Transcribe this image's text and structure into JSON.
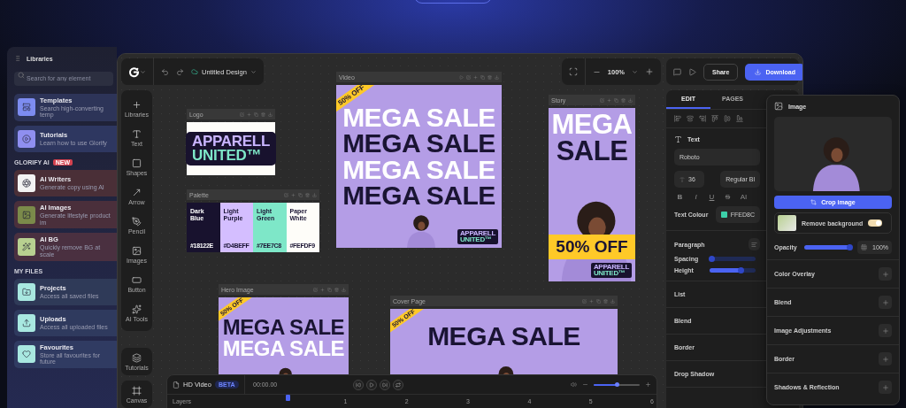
{
  "libraries": {
    "title": "Libraries",
    "search": {
      "placeholder": "Search for any element"
    },
    "groups": [
      {
        "items": [
          {
            "title": "Templates",
            "subtitle": "Search high-converting temp",
            "kind": "templates"
          },
          {
            "title": "Tutorials",
            "subtitle": "Learn how to use Glorify",
            "kind": "tutorials"
          }
        ]
      },
      {
        "heading": "GLORIFY AI",
        "badge": "NEW",
        "items": [
          {
            "title": "AI Writers",
            "subtitle": "Generate copy using AI",
            "kind": "writer"
          },
          {
            "title": "AI Images",
            "subtitle": "Generate lifestyle product im",
            "kind": "images"
          },
          {
            "title": "AI BG",
            "subtitle": "Quickly remove BG at scale",
            "kind": "bg"
          }
        ]
      },
      {
        "heading": "MY FILES",
        "items": [
          {
            "title": "Projects",
            "subtitle": "Access all saved files",
            "kind": "projects"
          },
          {
            "title": "Uploads",
            "subtitle": "Access all uploaded files",
            "kind": "uploads"
          },
          {
            "title": "Favourites",
            "subtitle": "Store all favourites for future",
            "kind": "favourites"
          }
        ]
      }
    ]
  },
  "topbar": {
    "design_title": "Untitled Design",
    "zoom": "100%",
    "share": "Share",
    "download": "Download"
  },
  "tools": [
    {
      "label": "Libraries",
      "kind": "plus"
    },
    {
      "label": "Text",
      "kind": "text"
    },
    {
      "label": "Shapes",
      "kind": "shapes"
    },
    {
      "label": "Arrow",
      "kind": "arrow"
    },
    {
      "label": "Pencil",
      "kind": "pencil"
    },
    {
      "label": "Images",
      "kind": "images"
    },
    {
      "label": "Button",
      "kind": "button"
    },
    {
      "label": "AI Tools",
      "kind": "ai"
    }
  ],
  "bottom_tools": [
    {
      "label": "Tutorials",
      "kind": "tutorials"
    },
    {
      "label": "Canvas",
      "kind": "canvas"
    }
  ],
  "artboards": [
    {
      "title": "Logo",
      "kind": "logo",
      "logo": [
        "APPARELL",
        "UNITED™"
      ]
    },
    {
      "title": "Palette",
      "kind": "palette",
      "swatches": [
        {
          "name": "Dark Blue",
          "hex": "#18122E",
          "color": "#18122e"
        },
        {
          "name": "Light Purple",
          "hex": "#D4BEFF",
          "color": "#d4beff"
        },
        {
          "name": "Light Green",
          "hex": "#7EE7C8",
          "color": "#7ee7c8"
        },
        {
          "name": "Paper White",
          "hex": "#FEFDF9",
          "color": "#fefdf9"
        }
      ]
    },
    {
      "title": "Video",
      "kind": "banner",
      "playable": true,
      "lines": [
        {
          "text": "MEGA SALE",
          "kind": "light"
        },
        {
          "text": "MEGA SALE",
          "kind": "dark"
        },
        {
          "text": "MEGA SALE",
          "kind": "light"
        },
        {
          "text": "MEGA SALE",
          "kind": "dark"
        }
      ],
      "badge": {
        "text": "50% OFF",
        "kind": "corner"
      },
      "logo": [
        "APPARELL",
        "UNITED™"
      ]
    },
    {
      "title": "Story",
      "kind": "banner",
      "lines": [
        {
          "text": "MEGA",
          "kind": "light"
        },
        {
          "text": "SALE",
          "kind": "dark"
        }
      ],
      "badge": {
        "text": "50% OFF",
        "kind": "strip"
      },
      "logo": [
        "APPARELL",
        "UNITED™"
      ]
    },
    {
      "title": "Hero Image",
      "kind": "banner",
      "lines": [
        {
          "text": "MEGA SALE",
          "kind": "dark"
        },
        {
          "text": "MEGA SALE",
          "kind": "light"
        }
      ],
      "badge": {
        "text": "50% OFF",
        "kind": "corner"
      }
    },
    {
      "title": "Cover Page",
      "kind": "banner",
      "lines": [
        {
          "text": "MEGA SALE",
          "kind": "dark"
        }
      ],
      "badge": {
        "text": "50% OFF",
        "kind": "corner"
      }
    }
  ],
  "timeline": {
    "title": "HD Video",
    "badge": "BETA",
    "time": "00:00.00",
    "zoom_slider": {
      "level": 0.5
    },
    "layers_label": "Layers",
    "ticks": [
      "1",
      "2",
      "3",
      "4",
      "5",
      "6"
    ]
  },
  "edit_panel": {
    "tabs": [
      {
        "label": "EDIT",
        "selected": true
      },
      {
        "label": "PAGES",
        "selected": false
      }
    ],
    "text": {
      "title": "Text",
      "font": "Roboto",
      "size": "36",
      "weight": "Regular Bl",
      "styles": [
        {
          "label": "B",
          "kind": "bold"
        },
        {
          "label": "I",
          "kind": "italic"
        },
        {
          "label": "U",
          "kind": "underline"
        },
        {
          "label": "S",
          "kind": "strike"
        },
        {
          "label": "AI",
          "kind": "plain"
        }
      ],
      "colour_label": "Text Colour",
      "colour_value": "FFED8C"
    },
    "paragraph": {
      "title": "Paragraph",
      "sliders": [
        {
          "label": "Spacing",
          "level": 0.04
        },
        {
          "label": "Height",
          "level": 0.68
        }
      ]
    },
    "sections": [
      "List",
      "Blend",
      "Border",
      "Drop Shadow"
    ]
  },
  "image_panel": {
    "title": "Image",
    "crop": "Crop image",
    "remove_bg": {
      "label": "Remove background",
      "on": true
    },
    "opacity": {
      "label": "Opacity",
      "level": 0.97,
      "reading": "100%"
    },
    "sections": [
      "Color Overlay",
      "Blend",
      "Image Adjustments",
      "Border",
      "Shadows & Reflection"
    ]
  }
}
